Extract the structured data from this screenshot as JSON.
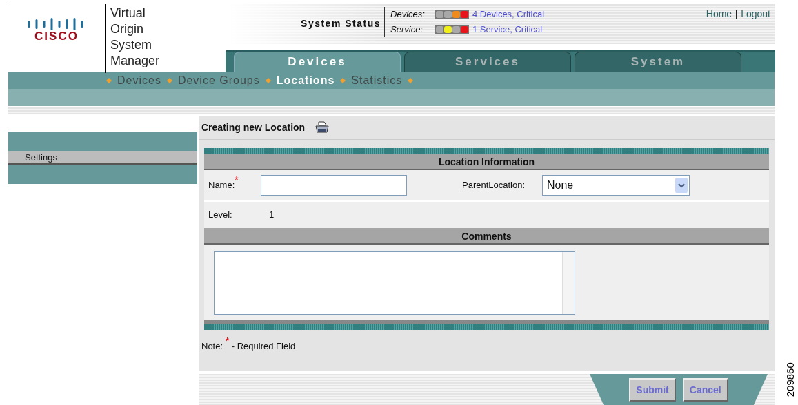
{
  "brand": {
    "logo": "CISCO",
    "product": [
      "Virtual",
      "Origin",
      "System",
      "Manager"
    ]
  },
  "system_status": {
    "title": "System Status",
    "rows": [
      {
        "label": "Devices:",
        "lights": [
          {
            "color": "#a8a8a8"
          },
          {
            "color": "#a8a8a8"
          },
          {
            "color": "#f08a1c"
          },
          {
            "color": "#e8141c"
          }
        ],
        "link": "4 Devices, Critical"
      },
      {
        "label": "Service:",
        "lights": [
          {
            "color": "#a8a8a8"
          },
          {
            "color": "#f0f018"
          },
          {
            "color": "#a8a8a8"
          },
          {
            "color": "#e8141c"
          }
        ],
        "link": "1 Service, Critical"
      }
    ]
  },
  "top_links": [
    "Home",
    "Logout"
  ],
  "tabs": [
    {
      "label": "Devices",
      "selected": true
    },
    {
      "label": "Services",
      "selected": false
    },
    {
      "label": "System",
      "selected": false
    }
  ],
  "subnav": [
    {
      "label": "Devices",
      "selected": false
    },
    {
      "label": "Device Groups",
      "selected": false
    },
    {
      "label": "Locations",
      "selected": true
    },
    {
      "label": "Statistics",
      "selected": false
    }
  ],
  "sidebar": {
    "items": [
      {
        "label": "Settings"
      }
    ]
  },
  "page_title": "Creating new Location",
  "location_section": {
    "title": "Location Information",
    "name_label": "Name:",
    "required_mark": "*",
    "parent_label": "ParentLocation:",
    "parent_value": "None",
    "level_label": "Level:",
    "level_value": "1"
  },
  "comments_section": {
    "title": "Comments"
  },
  "note": {
    "prefix": "Note:",
    "mark": "*",
    "text": "- Required Field"
  },
  "buttons": [
    "Submit",
    "Cancel"
  ],
  "figure_id": "209860"
}
